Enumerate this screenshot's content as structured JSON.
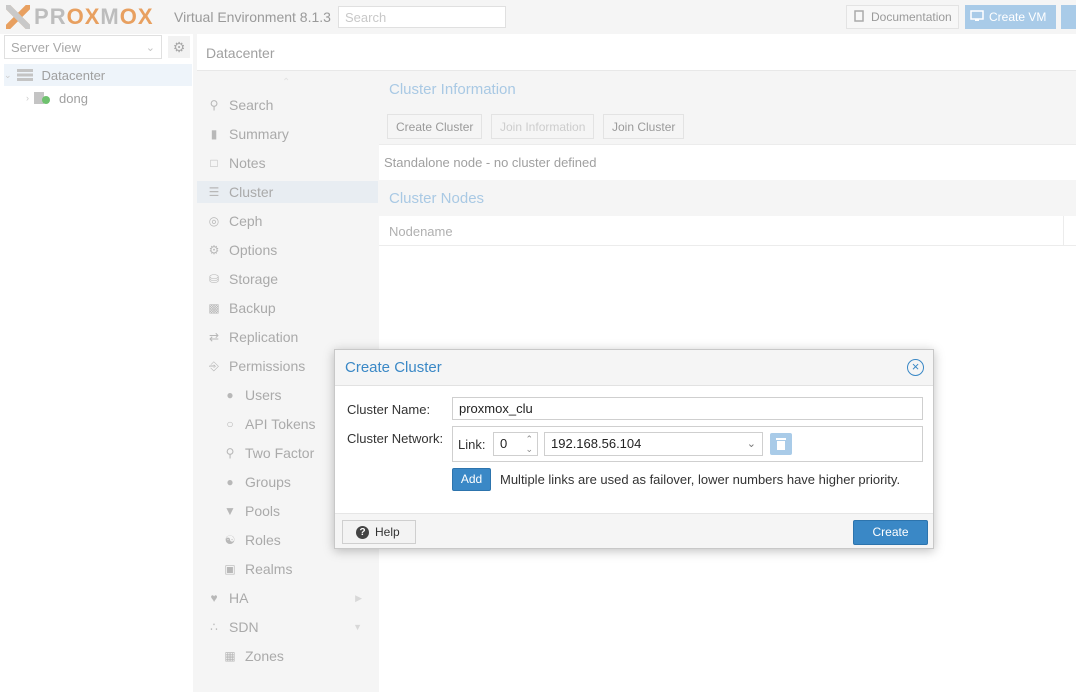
{
  "app": {
    "logo_text": "PROXMOX",
    "version": "Virtual Environment 8.1.3",
    "search_placeholder": "Search",
    "doc_label": "Documentation",
    "create_vm_label": "Create VM"
  },
  "tree": {
    "view": "Server View",
    "items": [
      {
        "label": "Datacenter",
        "icon": "server-rack-icon"
      },
      {
        "label": "dong",
        "icon": "node-online-icon"
      }
    ]
  },
  "breadcrumb": "Datacenter",
  "nav": {
    "items": [
      {
        "label": "Search",
        "icon": "search-icon"
      },
      {
        "label": "Summary",
        "icon": "book-icon"
      },
      {
        "label": "Notes",
        "icon": "note-icon"
      },
      {
        "label": "Cluster",
        "icon": "server-icon"
      },
      {
        "label": "Ceph",
        "icon": "ceph-icon"
      },
      {
        "label": "Options",
        "icon": "gear-icon"
      },
      {
        "label": "Storage",
        "icon": "database-icon"
      },
      {
        "label": "Backup",
        "icon": "floppy-icon"
      },
      {
        "label": "Replication",
        "icon": "retweet-icon"
      },
      {
        "label": "Permissions",
        "icon": "unlock-icon"
      },
      {
        "label": "Users",
        "icon": "user-icon"
      },
      {
        "label": "API Tokens",
        "icon": "user-outline-icon"
      },
      {
        "label": "Two Factor",
        "icon": "key-icon"
      },
      {
        "label": "Groups",
        "icon": "users-icon"
      },
      {
        "label": "Pools",
        "icon": "tags-icon"
      },
      {
        "label": "Roles",
        "icon": "male-icon"
      },
      {
        "label": "Realms",
        "icon": "address-book-icon"
      },
      {
        "label": "HA",
        "icon": "heartbeat-icon"
      },
      {
        "label": "SDN",
        "icon": "sdn-icon"
      },
      {
        "label": "Zones",
        "icon": "grid-icon"
      }
    ]
  },
  "cluster": {
    "info_title": "Cluster Information",
    "btn_create": "Create Cluster",
    "btn_join_info": "Join Information",
    "btn_join": "Join Cluster",
    "status": "Standalone node - no cluster defined",
    "nodes_title": "Cluster Nodes",
    "col_nodename": "Nodename"
  },
  "dialog": {
    "title": "Create Cluster",
    "name_label": "Cluster Name:",
    "name_value": "proxmox_clu",
    "network_label": "Cluster Network:",
    "link_label": "Link:",
    "link_number": "0",
    "link_address": "192.168.56.104",
    "add_label": "Add",
    "note": "Multiple links are used as failover, lower numbers have higher priority.",
    "help_label": "Help",
    "create_label": "Create"
  },
  "colors": {
    "accent": "#3a88c6",
    "accent_light": "#a9cbe8",
    "logo_orange": "#e57000"
  }
}
